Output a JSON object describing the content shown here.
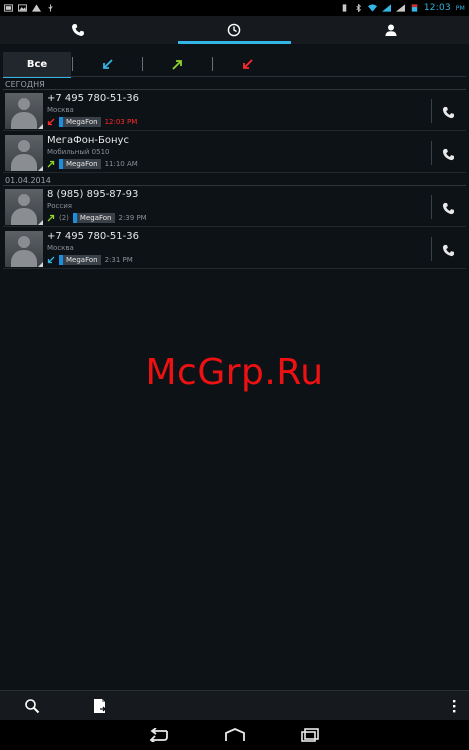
{
  "status_bar": {
    "time": "12:03",
    "suffix": "РМ"
  },
  "top_tabs": [
    {
      "name": "phone-icon"
    },
    {
      "name": "history-icon",
      "active": true
    },
    {
      "name": "contacts-icon"
    }
  ],
  "filters": {
    "all_label": "Все",
    "items": [
      {
        "name": "incoming-filter-icon",
        "color": "#33b5e5"
      },
      {
        "name": "outgoing-filter-icon",
        "color": "#8fd42b"
      },
      {
        "name": "missed-filter-icon",
        "color": "#ff2a2a"
      }
    ]
  },
  "sections": {
    "today": "СЕГОДНЯ",
    "date": "01.04.2014"
  },
  "calls": [
    {
      "name": "+7 495 780-51-36",
      "sub": "Москва",
      "type": "missed",
      "extra": "",
      "sim": "MegaFon",
      "time": "12:03 PM"
    },
    {
      "name": "МегаФон-Бонус",
      "sub": "Мобильный 0510",
      "type": "outgoing",
      "extra": "",
      "sim": "MegaFon",
      "time": "11:10 AM"
    },
    {
      "name": "8 (985) 895-87-93",
      "sub": "Россия",
      "type": "outgoing",
      "extra": "(2)",
      "sim": "MegaFon",
      "time": "2:39 PM"
    },
    {
      "name": "+7 495 780-51-36",
      "sub": "Москва",
      "type": "incoming",
      "extra": "",
      "sim": "MegaFon",
      "time": "2:31 PM"
    }
  ],
  "watermark": "McGrp.Ru",
  "colors": {
    "accent": "#33b5e5",
    "missed": "#ff2a2a",
    "outgoing": "#8fd42b",
    "incoming": "#33b5e5",
    "sim": "#1a8fe0"
  }
}
